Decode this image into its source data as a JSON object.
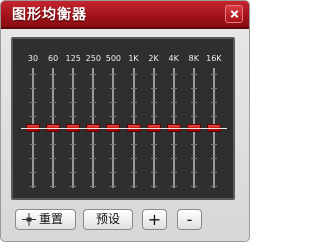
{
  "window": {
    "title": "图形均衡器"
  },
  "equalizer": {
    "bands": [
      {
        "freq": "30",
        "gain": 0
      },
      {
        "freq": "60",
        "gain": 0
      },
      {
        "freq": "125",
        "gain": 0
      },
      {
        "freq": "250",
        "gain": 0
      },
      {
        "freq": "500",
        "gain": 0
      },
      {
        "freq": "1K",
        "gain": 0
      },
      {
        "freq": "2K",
        "gain": 0
      },
      {
        "freq": "4K",
        "gain": 0
      },
      {
        "freq": "8K",
        "gain": 0
      },
      {
        "freq": "16K",
        "gain": 0
      }
    ]
  },
  "buttons": {
    "reset_label": "重置",
    "preset_label": "预设",
    "plus_label": "+",
    "minus_label": "-"
  },
  "colors": {
    "title_bar": "#a2131a",
    "knob": "#d01a1a",
    "panel": "#2f2f2f"
  }
}
